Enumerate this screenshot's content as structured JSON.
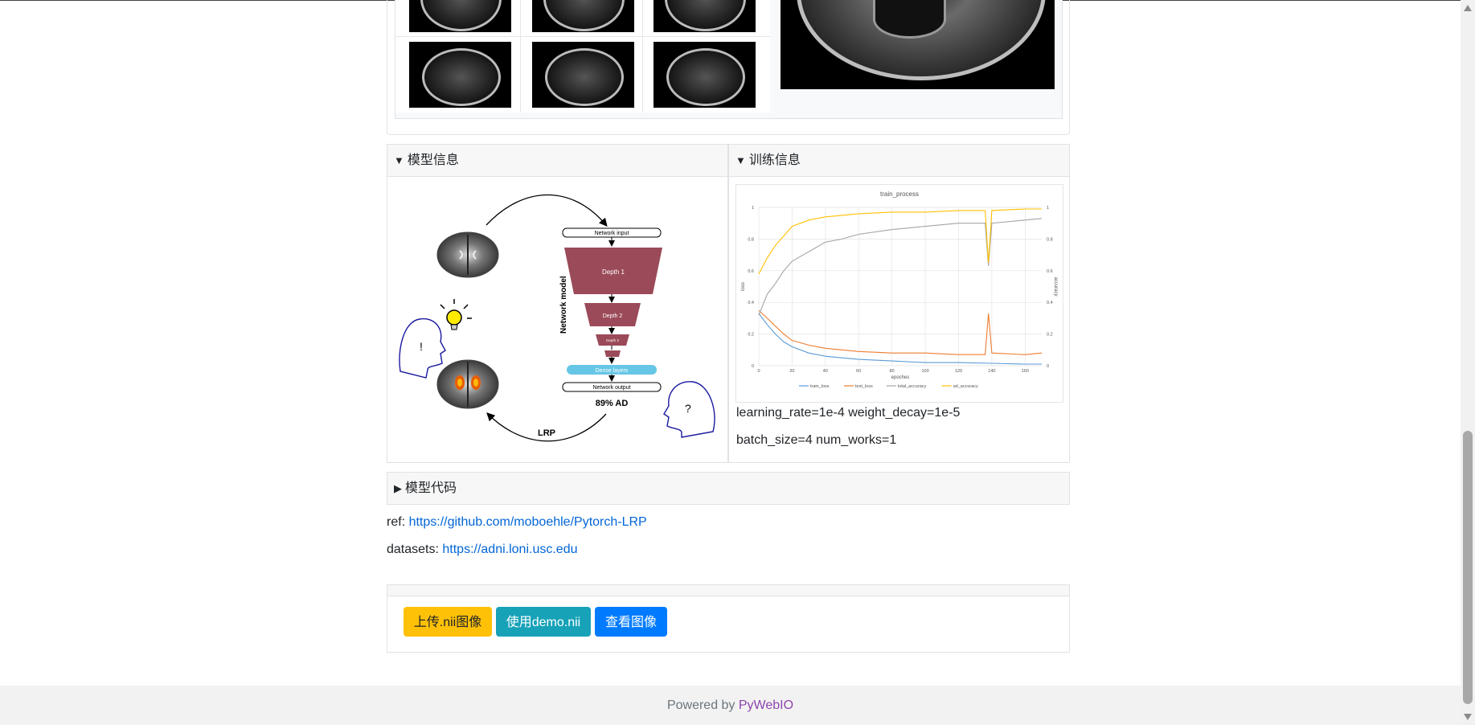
{
  "model_card": {
    "title": "模型信息"
  },
  "model_diagram": {
    "network_input": "Network input",
    "depth1": "Depth 1",
    "depth2": "Depth 2",
    "depth3": "Depth 3",
    "dense_layers": "Dense layers",
    "network_output": "Network output",
    "network_model": "Network model",
    "prediction": "89% AD",
    "lrp": "LRP",
    "exclaim": "!",
    "question": "?"
  },
  "train_card": {
    "title": "训练信息",
    "param_line1": "learning_rate=1e-4 weight_decay=1e-5",
    "param_line2": "batch_size=4 num_works=1"
  },
  "code_card": {
    "title": "模型代码"
  },
  "links": {
    "ref_label": "ref: ",
    "ref_url": "https://github.com/moboehle/Pytorch-LRP",
    "datasets_label": "datasets: ",
    "datasets_url": "https://adni.loni.usc.edu"
  },
  "buttons": {
    "upload": "上传.nii图像",
    "demo": "使用demo.nii",
    "view": "查看图像"
  },
  "footer": {
    "powered_by": "Powered by ",
    "brand": "PyWebIO"
  },
  "colors": {
    "warning": "#ffc107",
    "info": "#17a2b8",
    "primary": "#007bff",
    "link": "#0366d6",
    "brand": "#8e44ad"
  },
  "chart_data": {
    "type": "line",
    "title": "train_process",
    "xlabel": "epoches",
    "ylabel": "loss",
    "y2label": "accuracy",
    "xlim": [
      0,
      170
    ],
    "ylim": [
      0,
      1
    ],
    "x_ticks": [
      0,
      20,
      40,
      60,
      80,
      100,
      120,
      140,
      160
    ],
    "y_ticks": [
      0,
      0.2,
      0.4,
      0.6,
      0.8,
      1
    ],
    "grid": true,
    "legend_position": "bottom",
    "series": [
      {
        "name": "train_loss",
        "color": "#5b9bd5",
        "axis": "left",
        "x": [
          0,
          5,
          10,
          15,
          20,
          30,
          40,
          50,
          60,
          80,
          100,
          120,
          140,
          160,
          170
        ],
        "values": [
          0.33,
          0.26,
          0.2,
          0.15,
          0.12,
          0.08,
          0.06,
          0.05,
          0.04,
          0.03,
          0.02,
          0.02,
          0.015,
          0.01,
          0.01
        ]
      },
      {
        "name": "test_loss",
        "color": "#ed7d31",
        "axis": "left",
        "x": [
          0,
          5,
          10,
          15,
          20,
          30,
          40,
          50,
          60,
          80,
          100,
          120,
          136,
          138,
          140,
          160,
          170
        ],
        "values": [
          0.35,
          0.3,
          0.25,
          0.2,
          0.16,
          0.13,
          0.11,
          0.1,
          0.09,
          0.08,
          0.08,
          0.07,
          0.07,
          0.33,
          0.08,
          0.07,
          0.08
        ]
      },
      {
        "name": "total_accuracy",
        "color": "#a5a5a5",
        "axis": "right",
        "x": [
          0,
          5,
          10,
          15,
          20,
          30,
          40,
          50,
          60,
          80,
          100,
          120,
          136,
          138,
          140,
          160,
          170
        ],
        "values": [
          0.32,
          0.45,
          0.52,
          0.6,
          0.66,
          0.72,
          0.78,
          0.8,
          0.83,
          0.86,
          0.88,
          0.9,
          0.9,
          0.63,
          0.9,
          0.92,
          0.93
        ]
      },
      {
        "name": "ad_accuracy",
        "color": "#ffc000",
        "axis": "right",
        "x": [
          0,
          5,
          10,
          15,
          20,
          30,
          40,
          50,
          60,
          80,
          100,
          120,
          136,
          138,
          140,
          160,
          170
        ],
        "values": [
          0.58,
          0.68,
          0.76,
          0.82,
          0.88,
          0.92,
          0.94,
          0.95,
          0.96,
          0.97,
          0.97,
          0.98,
          0.98,
          0.65,
          0.98,
          0.99,
          0.99
        ]
      }
    ]
  }
}
